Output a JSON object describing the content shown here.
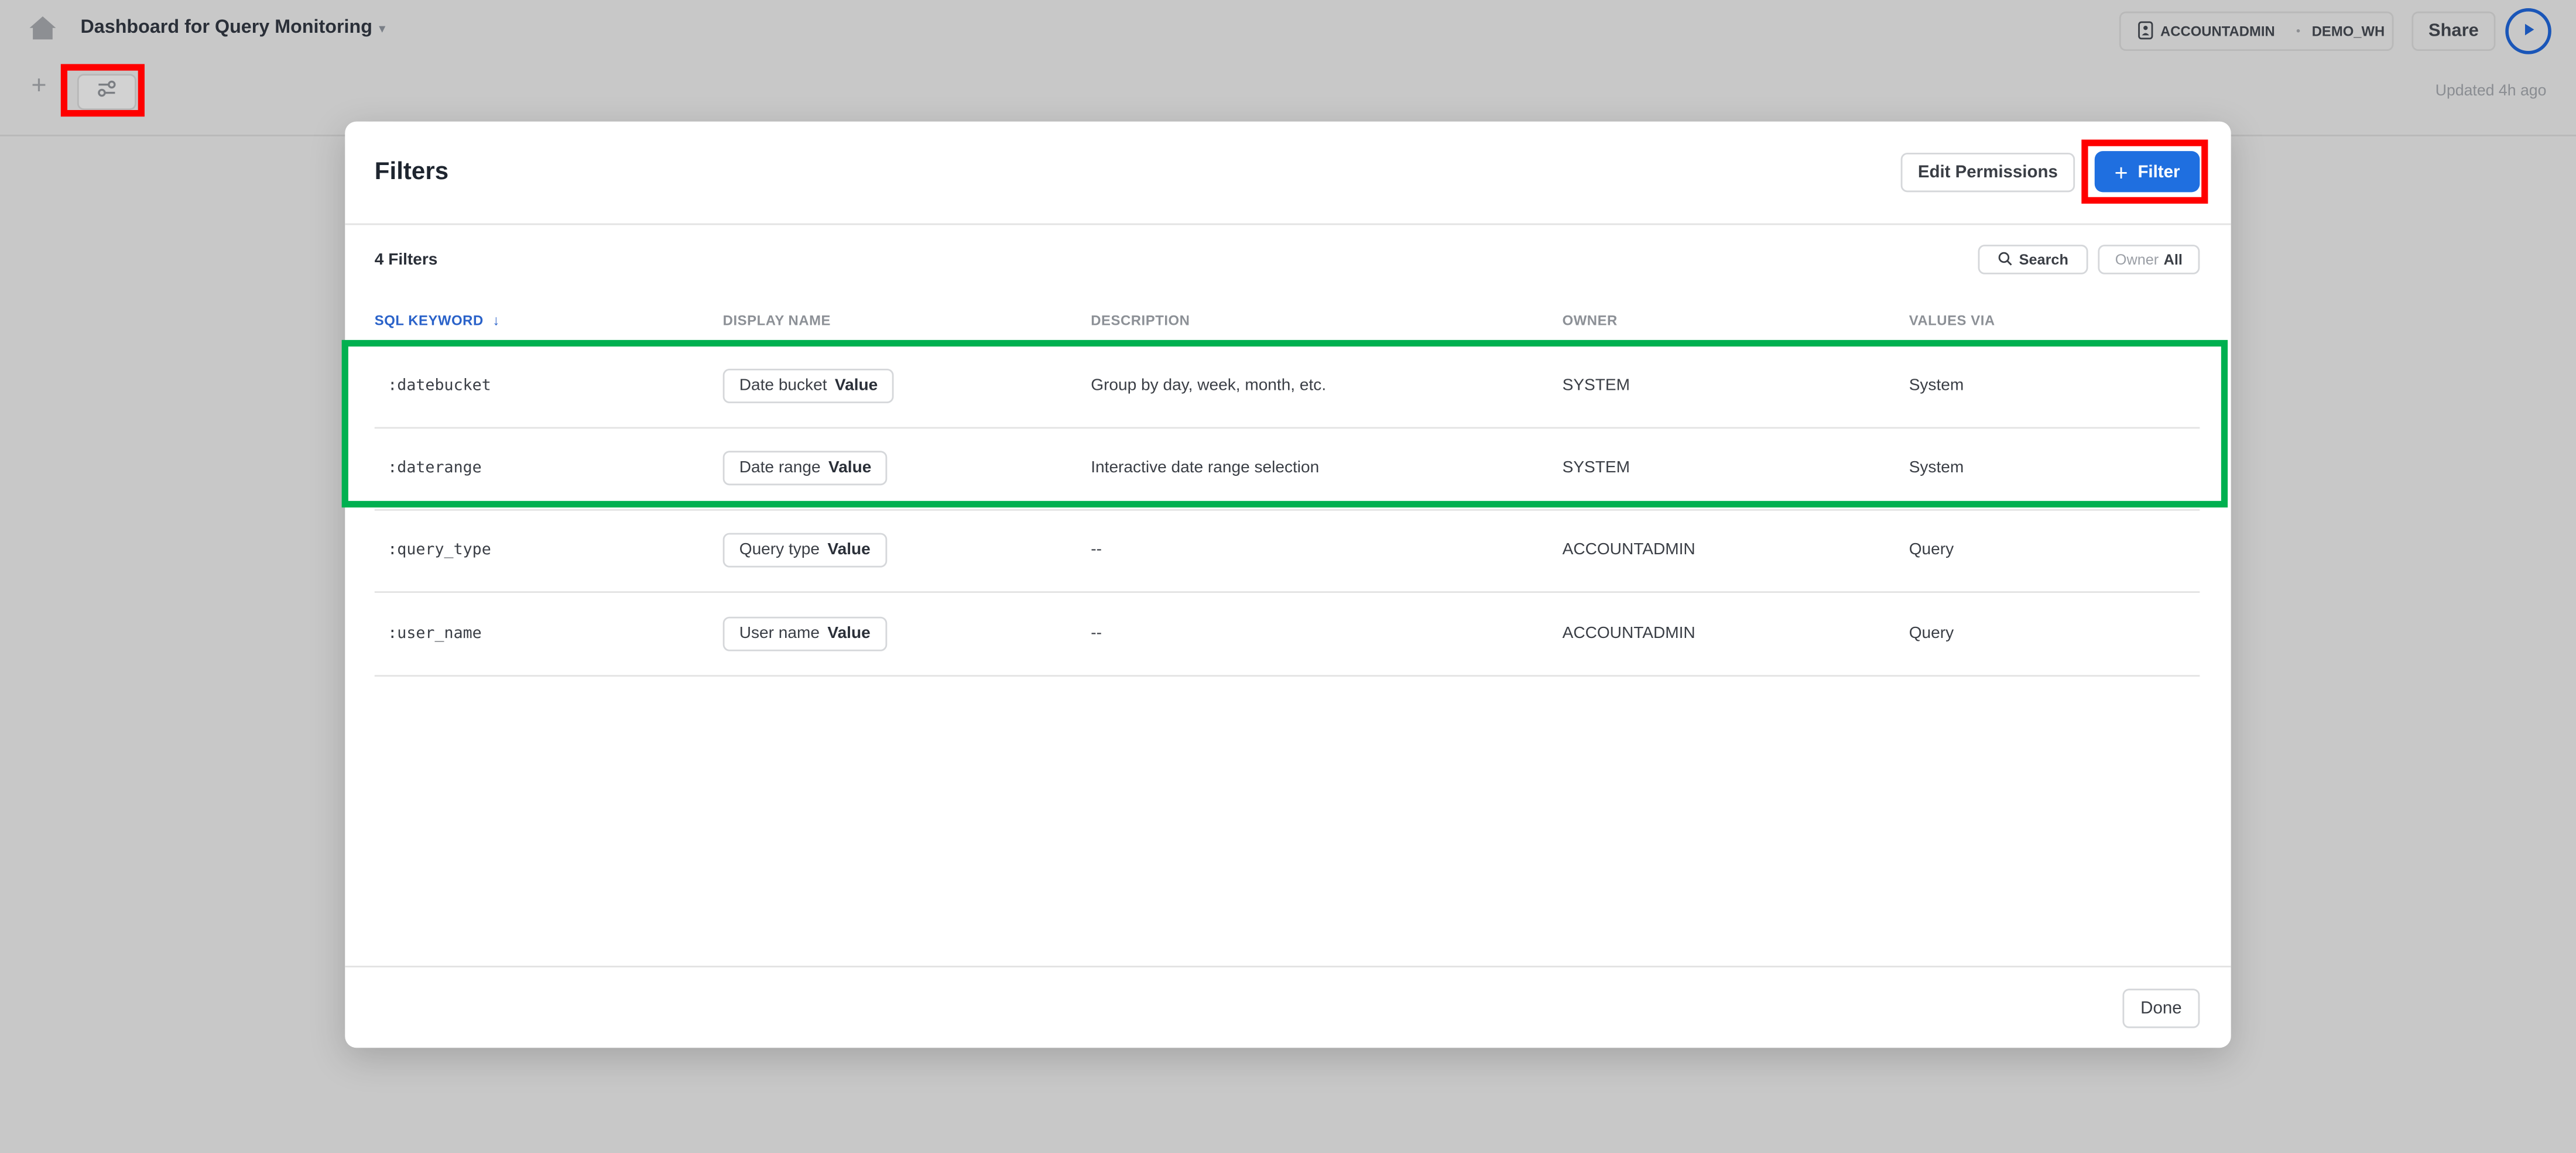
{
  "topbar": {
    "home_icon": "home-icon",
    "dashboard_title": "Dashboard for Query Monitoring",
    "dashboard_caret": "▾",
    "add_label": "+",
    "filters_toggle_icon": "sliders-icon",
    "context": {
      "role": "ACCOUNTADMIN",
      "separator": "•",
      "warehouse": "DEMO_WH"
    },
    "share_label": "Share",
    "run_icon": "play-icon",
    "updated_text": "Updated 4h ago"
  },
  "modal": {
    "title": "Filters",
    "edit_permissions_label": "Edit Permissions",
    "add_filter_plus": "+",
    "add_filter_label": "Filter",
    "count_label": "4 Filters",
    "search_label": "Search",
    "owner_label": "Owner",
    "owner_value": "All",
    "columns": [
      {
        "label": "SQL KEYWORD",
        "sorted": true,
        "sort_icon": "↓"
      },
      {
        "label": "DISPLAY NAME"
      },
      {
        "label": "DESCRIPTION"
      },
      {
        "label": "OWNER"
      },
      {
        "label": "VALUES VIA"
      }
    ],
    "rows": [
      {
        "keyword": ":datebucket",
        "display_name": "Date bucket",
        "display_suffix": "Value",
        "description": "Group by day, week, month, etc.",
        "owner": "SYSTEM",
        "values_via": "System"
      },
      {
        "keyword": ":daterange",
        "display_name": "Date range",
        "display_suffix": "Value",
        "description": "Interactive date range selection",
        "owner": "SYSTEM",
        "values_via": "System"
      },
      {
        "keyword": ":query_type",
        "display_name": "Query type",
        "display_suffix": "Value",
        "description": "--",
        "owner": "ACCOUNTADMIN",
        "values_via": "Query"
      },
      {
        "keyword": ":user_name",
        "display_name": "User name",
        "display_suffix": "Value",
        "description": "--",
        "owner": "ACCOUNTADMIN",
        "values_via": "Query"
      }
    ],
    "done_label": "Done"
  },
  "annotations": {
    "red_highlight_color": "#ff0000",
    "green_highlight_color": "#00b050"
  },
  "colors": {
    "primary": "#1f6fe0",
    "run_button": "#1a56b8",
    "sorted_header": "#2a62c9",
    "backdrop": "#c8c8c8"
  }
}
